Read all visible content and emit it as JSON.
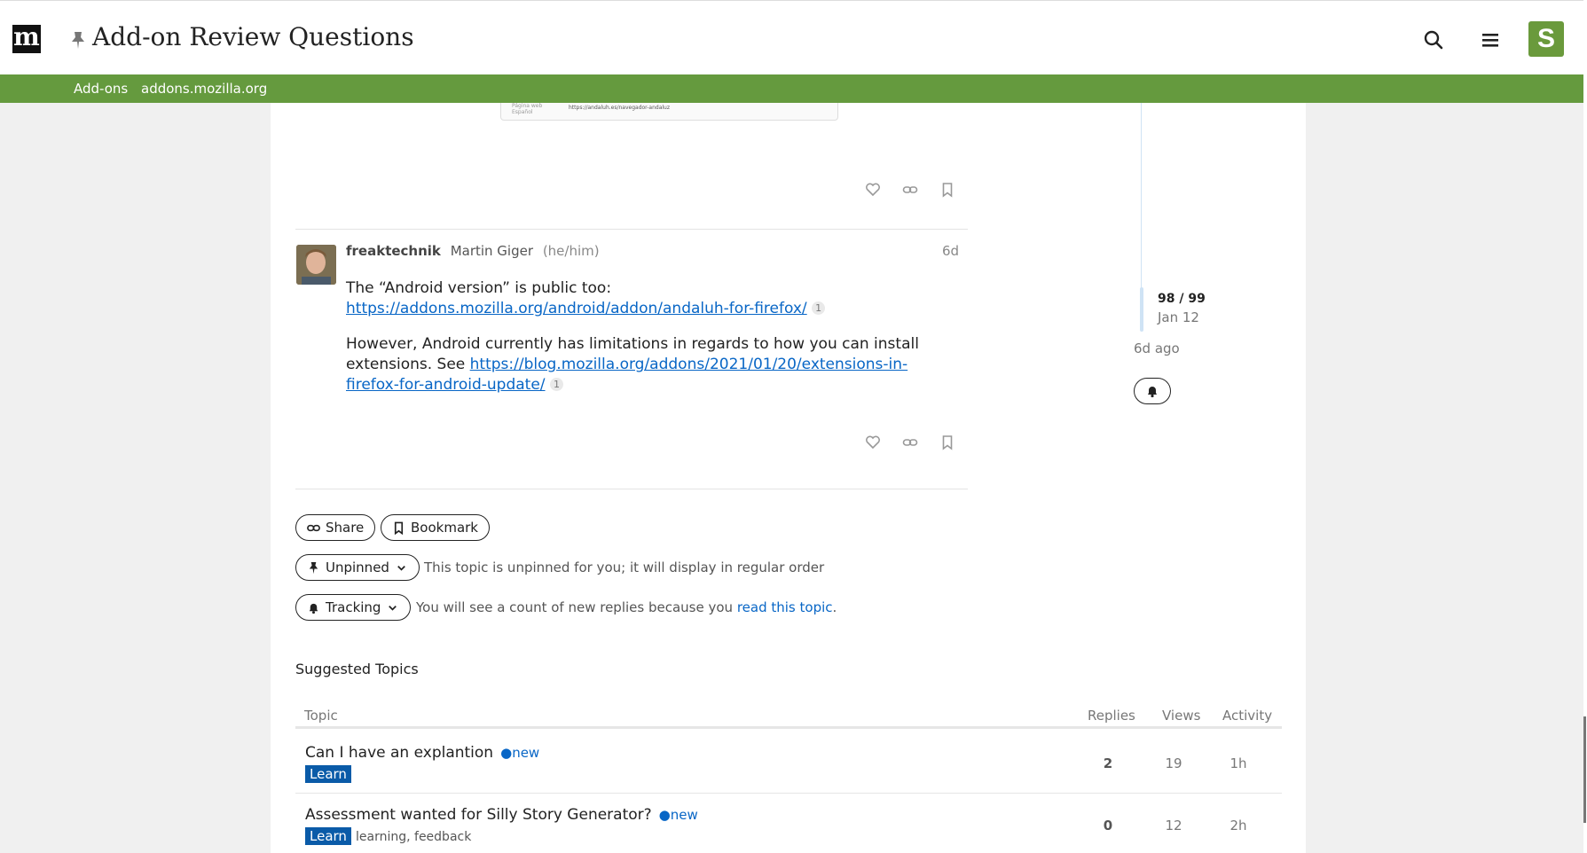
{
  "header": {
    "logo_text": "m",
    "title": "Add-on Review Questions"
  },
  "avatar_letter": "S",
  "category_bar": {
    "parent": "Add-ons",
    "child": "addons.mozilla.org"
  },
  "image_stub": {
    "label": "Página web",
    "sublabel": "Español",
    "url": "https://andaluh.es/navegador-andaluz"
  },
  "post": {
    "username": "freaktechnik",
    "full_name": "Martin Giger",
    "pronouns": "(he/him)",
    "date": "6d",
    "p1_text": "The “Android version” is public too:",
    "p1_link": "https://addons.mozilla.org/android/addon/andaluh-for-firefox/",
    "p1_clicks": "1",
    "p2_text": "However, Android currently has limitations in regards to how you can install extensions. See ",
    "p2_link": "https://blog.mozilla.org/addons/2021/01/20/extensions-in-firefox-for-android-update/",
    "p2_clicks": "1"
  },
  "footer_buttons": {
    "share": "Share",
    "bookmark": "Bookmark",
    "unpinned": "Unpinned",
    "unpinned_note": "This topic is unpinned for you; it will display in regular order",
    "tracking": "Tracking",
    "tracking_note": "You will see a count of new replies because you ",
    "tracking_link": "read this topic",
    "tracking_end": "."
  },
  "timeline": {
    "count": "98 / 99",
    "date": "Jan 12",
    "ago": "6d ago"
  },
  "suggested": {
    "title": "Suggested Topics",
    "columns": [
      "Topic",
      "Replies",
      "Views",
      "Activity"
    ],
    "rows": [
      {
        "title": "Can I have an explantion",
        "badge": "new",
        "category": "Learn",
        "tags": "",
        "replies": "2",
        "views": "19",
        "activity": "1h"
      },
      {
        "title": "Assessment wanted for Silly Story Generator?",
        "badge": "new",
        "category": "Learn",
        "tags": "learning, feedback",
        "replies": "0",
        "views": "12",
        "activity": "2h"
      }
    ]
  },
  "colors": {
    "category_bar": "#659a3e",
    "avatar_bg": "#6a9a3c",
    "link": "#0866c6",
    "category_badge": "#0a5ba8"
  }
}
